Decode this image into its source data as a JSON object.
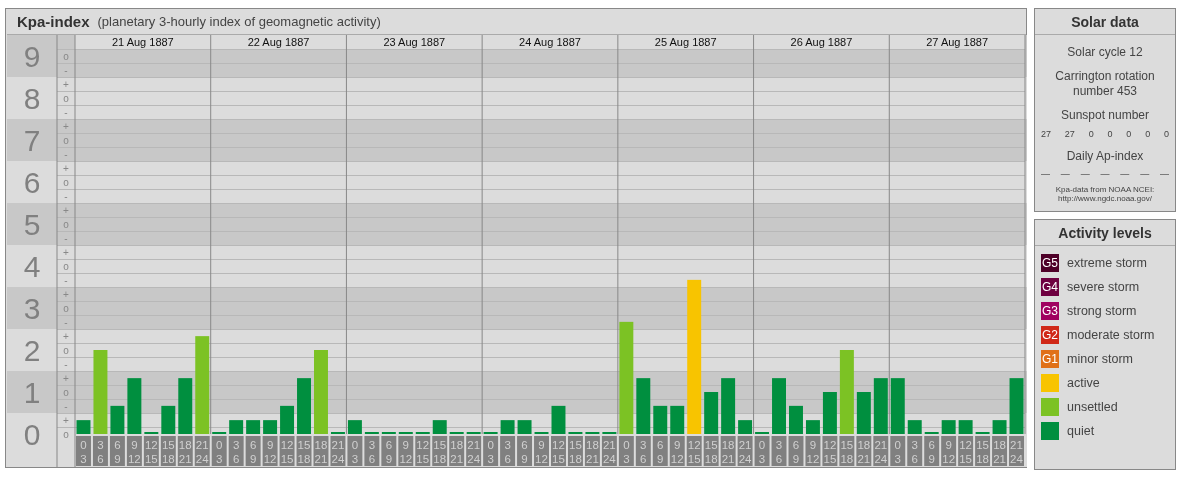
{
  "header": {
    "title": "Kpa-index",
    "subtitle": "(planetary 3-hourly index of geomagnetic activity)"
  },
  "scale": [
    {
      "marks": [
        "o",
        "-"
      ]
    },
    {
      "marks": [
        "+",
        "o",
        "-"
      ]
    },
    {
      "marks": [
        "+",
        "o",
        "-"
      ]
    },
    {
      "marks": [
        "+",
        "o",
        "-"
      ]
    },
    {
      "marks": [
        "+",
        "o",
        "-"
      ]
    },
    {
      "marks": [
        "+",
        "o",
        "-"
      ]
    },
    {
      "marks": [
        "+",
        "o",
        "-"
      ]
    },
    {
      "marks": [
        "+",
        "o",
        "-"
      ]
    },
    {
      "marks": [
        "+",
        "o",
        "-"
      ]
    },
    {
      "marks": [
        "+",
        "o"
      ]
    }
  ],
  "days": [
    {
      "date": "21 Aug 1887",
      "slots": [
        "3",
        "6",
        "9",
        "12",
        "15",
        "18",
        "21",
        "24"
      ]
    },
    {
      "date": "22 Aug 1887",
      "slots": [
        "3",
        "6",
        "9",
        "12",
        "15",
        "18",
        "21",
        "24"
      ]
    },
    {
      "date": "23 Aug 1887",
      "slots": [
        "3",
        "6",
        "9",
        "12",
        "15",
        "18",
        "21",
        "24"
      ]
    },
    {
      "date": "24 Aug 1887",
      "slots": [
        "3",
        "6",
        "9",
        "12",
        "15",
        "18",
        "21",
        "24"
      ]
    },
    {
      "date": "25 Aug 1887",
      "slots": [
        "3",
        "6",
        "9",
        "12",
        "15",
        "18",
        "21",
        "24"
      ]
    },
    {
      "date": "26 Aug 1887",
      "slots": [
        "3",
        "6",
        "9",
        "12",
        "15",
        "18",
        "21",
        "24"
      ]
    },
    {
      "date": "27 Aug 1887",
      "slots": [
        "3",
        "6",
        "9",
        "12",
        "15",
        "18",
        "21",
        "24"
      ]
    }
  ],
  "chart_data": {
    "type": "bar",
    "stacked": true,
    "ylim": [
      0,
      9.5
    ],
    "yticks": [
      0,
      1,
      2,
      3,
      4,
      5,
      6,
      7,
      8,
      9
    ],
    "categories": [
      "0",
      "3",
      "6",
      "9",
      "12",
      "15",
      "18",
      "21",
      "0",
      "3",
      "6",
      "9",
      "12",
      "15",
      "18",
      "21",
      "0",
      "3",
      "6",
      "9",
      "12",
      "15",
      "18",
      "21",
      "0",
      "3",
      "6",
      "9",
      "12",
      "15",
      "18",
      "21",
      "0",
      "3",
      "6",
      "9",
      "12",
      "15",
      "18",
      "21",
      "0",
      "3",
      "6",
      "9",
      "12",
      "15",
      "18",
      "21",
      "0",
      "3",
      "6",
      "9",
      "12",
      "15",
      "18",
      "21"
    ],
    "series": [
      {
        "color": "#008f3f",
        "values": [
          0.33,
          null,
          0.67,
          1.33,
          0,
          0.67,
          1.33,
          null,
          0,
          0.33,
          0.33,
          0.33,
          0.67,
          1.33,
          null,
          0,
          0.33,
          0,
          0,
          0,
          0,
          0.33,
          0,
          0,
          0,
          0.33,
          0.33,
          0,
          0.67,
          0,
          0,
          0,
          null,
          1.33,
          0.67,
          0.67,
          null,
          1,
          1.33,
          0.33,
          0,
          1.33,
          0.67,
          0.33,
          1,
          null,
          1,
          1.33,
          1.33,
          0.33,
          0,
          0.33,
          0.33,
          0,
          0.33,
          1.33
        ]
      },
      {
        "color": "#7cc224",
        "values": [
          null,
          2,
          null,
          null,
          null,
          null,
          null,
          2.33,
          null,
          null,
          null,
          null,
          null,
          null,
          2,
          null,
          null,
          null,
          null,
          null,
          null,
          null,
          null,
          null,
          null,
          null,
          null,
          null,
          null,
          null,
          null,
          null,
          2.67,
          null,
          null,
          null,
          null,
          null,
          null,
          null,
          null,
          null,
          null,
          null,
          null,
          2,
          null,
          null,
          null,
          null,
          null,
          null,
          null,
          null,
          null,
          null
        ]
      },
      {
        "color": "#f8c400",
        "values": [
          null,
          null,
          null,
          null,
          null,
          null,
          null,
          null,
          null,
          null,
          null,
          null,
          null,
          null,
          null,
          null,
          null,
          null,
          null,
          null,
          null,
          null,
          null,
          null,
          null,
          null,
          null,
          null,
          null,
          null,
          null,
          null,
          null,
          null,
          null,
          null,
          3.67,
          null,
          null,
          null,
          null,
          null,
          null,
          null,
          null,
          null,
          null,
          null,
          null,
          null,
          null,
          null,
          null,
          null,
          null,
          null
        ]
      }
    ]
  },
  "solar_data": {
    "title": "Solar data",
    "solar_cycle": "Solar cycle 12",
    "carrington": "Carrington rotation number 453",
    "sunspot_label": "Sunspot number",
    "sunspot_numbers": [
      "27",
      "27",
      "0",
      "0",
      "0",
      "0",
      "0"
    ],
    "ap_label": "Daily Ap-index",
    "ap_values": [
      "—",
      "—",
      "—",
      "—",
      "—",
      "—",
      "—"
    ],
    "source": "Kpa-data from NOAA NCEI:",
    "source_url": "http://www.ngdc.noaa.gov/"
  },
  "activity_levels": {
    "title": "Activity levels",
    "items": [
      {
        "code": "G5",
        "label": "extreme storm",
        "color": "#4e0028"
      },
      {
        "code": "G4",
        "label": "severe storm",
        "color": "#6e0040"
      },
      {
        "code": "G3",
        "label": "strong storm",
        "color": "#a00060"
      },
      {
        "code": "G2",
        "label": "moderate storm",
        "color": "#d02818"
      },
      {
        "code": "G1",
        "label": "minor storm",
        "color": "#e07018"
      },
      {
        "label": "active",
        "color": "#f8c400"
      },
      {
        "label": "unsettled",
        "color": "#7cc224"
      },
      {
        "label": "quiet",
        "color": "#008f3f"
      }
    ]
  }
}
